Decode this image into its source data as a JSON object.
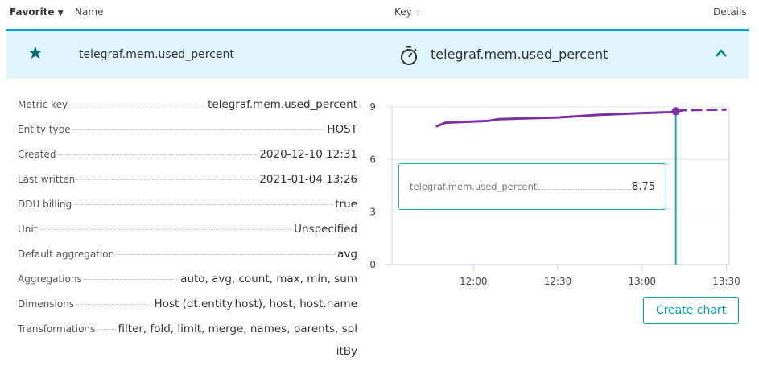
{
  "header": {
    "favorite": "Favorite",
    "name": "Name",
    "key": "Key",
    "details": "Details"
  },
  "row": {
    "name": "telegraf.mem.used_percent",
    "key": "telegraf.mem.used_percent"
  },
  "properties": [
    {
      "k": "Metric key",
      "v": "telegraf.mem.used_percent"
    },
    {
      "k": "Entity type",
      "v": "HOST"
    },
    {
      "k": "Created",
      "v": "2020-12-10 12:31"
    },
    {
      "k": "Last written",
      "v": "2021-01-04 13:26"
    },
    {
      "k": "DDU billing",
      "v": "true"
    },
    {
      "k": "Unit",
      "v": "Unspecified"
    },
    {
      "k": "Default aggregation",
      "v": "avg"
    },
    {
      "k": "Aggregations",
      "v": "auto, avg, count, max, min, sum"
    },
    {
      "k": "Dimensions",
      "v": "Host (dt.entity.host), host, host.name"
    },
    {
      "k": "Transformations",
      "v": "filter, fold, limit, merge, names, parents, spl"
    }
  ],
  "transformations_wrap": "itBy",
  "create_chart": "Create chart",
  "tooltip": {
    "series": "telegraf.mem.used_percent",
    "value": "8.75"
  },
  "chart_data": {
    "type": "line",
    "ylim": [
      0,
      9
    ],
    "yticks": [
      0,
      3,
      6,
      9
    ],
    "xlim_minutes_after_1130": [
      1,
      121
    ],
    "xticks": [
      {
        "m": 30,
        "label": "12:00"
      },
      {
        "m": 60,
        "label": "12:30"
      },
      {
        "m": 90,
        "label": "13:00"
      },
      {
        "m": 120,
        "label": "13:30"
      }
    ],
    "series": [
      {
        "name": "telegraf.mem.used_percent",
        "color": "#7c2fa3",
        "points": [
          [
            17,
            7.9
          ],
          [
            20,
            8.1
          ],
          [
            35,
            8.2
          ],
          [
            39,
            8.3
          ],
          [
            60,
            8.4
          ],
          [
            75,
            8.55
          ],
          [
            90,
            8.65
          ],
          [
            100,
            8.7
          ],
          [
            102,
            8.75
          ]
        ],
        "forecast_dashed": [
          [
            102,
            8.75
          ],
          [
            105,
            8.82
          ],
          [
            120,
            8.85
          ]
        ]
      }
    ],
    "cursor_minute": 102,
    "cursor_color": "#16aebb"
  }
}
